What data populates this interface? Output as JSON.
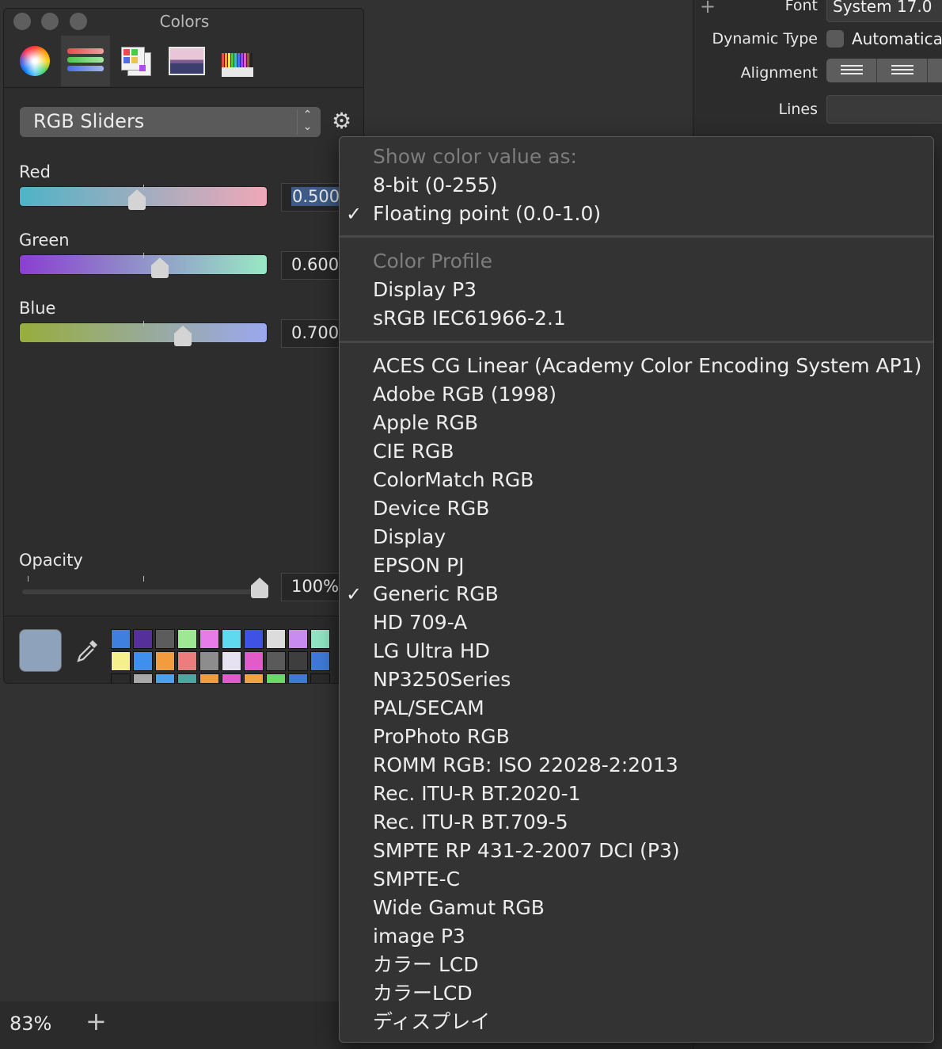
{
  "inspector": {
    "font_label": "Font",
    "font_value": "System 17.0",
    "dynamic_type_label": "Dynamic Type",
    "dynamic_type_value": "Automatica",
    "alignment_label": "Alignment",
    "lines_label": "Lines"
  },
  "colors_panel": {
    "title": "Colors",
    "modes": [
      "color-wheel",
      "color-sliders",
      "color-palettes",
      "image-palettes",
      "pencils"
    ],
    "selected_mode": "color-sliders",
    "mode_select": "RGB Sliders",
    "channels": [
      {
        "label": "Red",
        "value": "0.500",
        "level": 0.5
      },
      {
        "label": "Green",
        "value": "0.600",
        "level": 0.6
      },
      {
        "label": "Blue",
        "value": "0.700",
        "level": 0.7
      }
    ],
    "opacity": {
      "label": "Opacity",
      "value": "100%",
      "level": 1.0
    },
    "current_color": "#8ea3bb",
    "swatches": [
      "#3f7fe0",
      "#55309a",
      "#5c5c5c",
      "#9ee894",
      "#e77be8",
      "#5fd9ef",
      "#3f52e6",
      "#dcdcdc",
      "#c88cf0",
      "#8de3c2",
      "#f5f08c",
      "#3f8fef",
      "#f29c3e",
      "#ec7d7d",
      "#8d8d8d",
      "#e7e2f2",
      "#e25bc9",
      "#5a5a5a",
      "#3e3e3e",
      "#3f78d6",
      "#2a2a2a",
      "#a8a8a8",
      "#4aa1ef",
      "#4aa8a0",
      "#f29c3e",
      "#e25bc9",
      "#f2a23e",
      "#68d86a",
      "#3f78d6",
      "#2a2a2a"
    ]
  },
  "status_bar": {
    "zoom": "83%"
  },
  "menu": {
    "section1_header": "Show color value as:",
    "section1_items": [
      {
        "label": "8-bit (0-255)",
        "checked": false
      },
      {
        "label": "Floating point (0.0-1.0)",
        "checked": true
      }
    ],
    "section2_header": "Color Profile",
    "section2_items": [
      {
        "label": "Display P3",
        "checked": false
      },
      {
        "label": "sRGB IEC61966-2.1",
        "checked": false
      }
    ],
    "profiles": [
      {
        "label": "ACES CG Linear (Academy Color Encoding System AP1)",
        "checked": false
      },
      {
        "label": "Adobe RGB (1998)",
        "checked": false
      },
      {
        "label": "Apple RGB",
        "checked": false
      },
      {
        "label": "CIE RGB",
        "checked": false
      },
      {
        "label": "ColorMatch RGB",
        "checked": false
      },
      {
        "label": "Device RGB",
        "checked": false
      },
      {
        "label": "Display",
        "checked": false
      },
      {
        "label": "EPSON PJ",
        "checked": false
      },
      {
        "label": "Generic RGB",
        "checked": true
      },
      {
        "label": "HD 709-A",
        "checked": false
      },
      {
        "label": "LG Ultra HD",
        "checked": false
      },
      {
        "label": "NP3250Series",
        "checked": false
      },
      {
        "label": "PAL/SECAM",
        "checked": false
      },
      {
        "label": "ProPhoto RGB",
        "checked": false
      },
      {
        "label": "ROMM RGB: ISO 22028-2:2013",
        "checked": false
      },
      {
        "label": "Rec. ITU-R BT.2020-1",
        "checked": false
      },
      {
        "label": "Rec. ITU-R BT.709-5",
        "checked": false
      },
      {
        "label": "SMPTE RP 431-2-2007 DCI (P3)",
        "checked": false
      },
      {
        "label": "SMPTE-C",
        "checked": false
      },
      {
        "label": "Wide Gamut RGB",
        "checked": false
      },
      {
        "label": "image P3",
        "checked": false
      },
      {
        "label": "カラー LCD",
        "checked": false
      },
      {
        "label": "カラーLCD",
        "checked": false
      },
      {
        "label": "ディスプレイ",
        "checked": false
      }
    ]
  }
}
